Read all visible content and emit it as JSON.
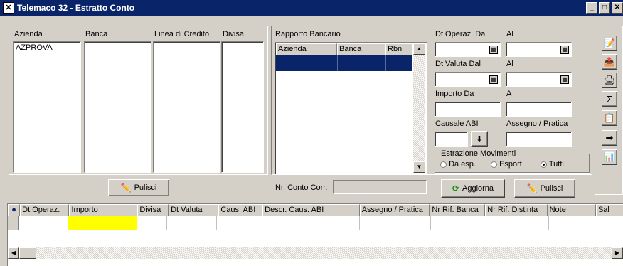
{
  "window": {
    "title": "Telemaco 32 - Estratto Conto",
    "controls": {
      "minimize": "_",
      "maximize": "□",
      "close": "✕"
    }
  },
  "left_panel": {
    "columns": [
      "Azienda",
      "Banca",
      "Linea di Credito",
      "Divisa"
    ],
    "azienda_items": [
      "AZPROVA"
    ],
    "pulisci_label": "Pulisci"
  },
  "rapporto": {
    "label": "Rapporto Bancario",
    "columns": [
      "Azienda",
      "Banca",
      "Rbn"
    ],
    "nr_conto_label": "Nr. Conto Corr."
  },
  "filters": {
    "dt_operaz_dal": "Dt Operaz. Dal",
    "al1": "Al",
    "dt_valuta_dal": "Dt Valuta Dal",
    "al2": "Al",
    "importo_da": "Importo Da",
    "a": "A",
    "causale_abi": "Causale ABI",
    "assegno_pratica": "Assegno / Pratica",
    "estrazione": {
      "title": "Estrazione Movimenti",
      "options": [
        "Da esp.",
        "Esport.",
        "Tutti"
      ],
      "selected": "Tutti"
    },
    "aggiorna_label": "Aggiorna",
    "pulisci_label": "Pulisci"
  },
  "sidebar_icons": [
    "edit-icon",
    "export-icon",
    "print-icon",
    "sum-icon",
    "copy-icon",
    "exit-icon",
    "report-icon"
  ],
  "grid": {
    "columns": [
      "Dt Operaz.",
      "Importo",
      "Divisa",
      "Dt Valuta",
      "Caus. ABI",
      "Descr. Caus. ABI",
      "Assegno / Pratica",
      "Nr Rif. Banca",
      "Nr Rif. Distinta",
      "Note",
      "Sal"
    ]
  },
  "colors": {
    "title_bar": "#0a246a",
    "face": "#d4d0c8",
    "selection": "#0a246a",
    "highlight_cell": "#ffff00"
  }
}
